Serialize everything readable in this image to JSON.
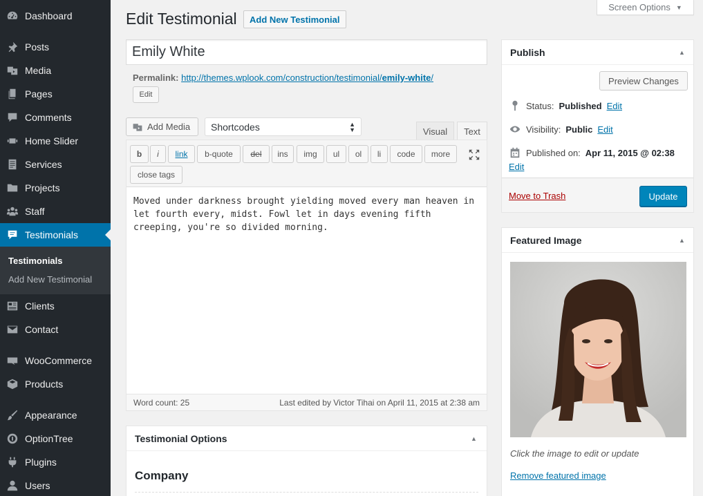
{
  "sidebar": {
    "items": [
      {
        "label": "Dashboard",
        "icon": "dashboard-icon"
      },
      {
        "label": "Posts",
        "icon": "pin-icon"
      },
      {
        "label": "Media",
        "icon": "media-icon"
      },
      {
        "label": "Pages",
        "icon": "pages-icon"
      },
      {
        "label": "Comments",
        "icon": "comments-icon"
      },
      {
        "label": "Home Slider",
        "icon": "slider-icon"
      },
      {
        "label": "Services",
        "icon": "services-icon"
      },
      {
        "label": "Projects",
        "icon": "folder-icon"
      },
      {
        "label": "Staff",
        "icon": "staff-icon"
      },
      {
        "label": "Testimonials",
        "icon": "testimonial-icon"
      },
      {
        "label": "Clients",
        "icon": "clients-icon"
      },
      {
        "label": "Contact",
        "icon": "mail-icon"
      },
      {
        "label": "WooCommerce",
        "icon": "woocommerce-icon"
      },
      {
        "label": "Products",
        "icon": "products-icon"
      },
      {
        "label": "Appearance",
        "icon": "brush-icon"
      },
      {
        "label": "OptionTree",
        "icon": "optiontree-icon"
      },
      {
        "label": "Plugins",
        "icon": "plugin-icon"
      },
      {
        "label": "Users",
        "icon": "user-icon"
      }
    ],
    "submenu": [
      "Testimonials",
      "Add New Testimonial"
    ]
  },
  "screen_options": "Screen Options",
  "page": {
    "title": "Edit Testimonial",
    "add_new": "Add New Testimonial",
    "post_title": "Emily White",
    "permalink_label": "Permalink:",
    "permalink_base": "http://themes.wplook.com/construction/testimonial/",
    "permalink_slug": "emily-white",
    "permalink_trail": "/",
    "permalink_edit": "Edit"
  },
  "editor": {
    "add_media": "Add Media",
    "shortcodes": "Shortcodes",
    "tab_visual": "Visual",
    "tab_text": "Text",
    "quicktags": [
      "b",
      "i",
      "link",
      "b-quote",
      "del",
      "ins",
      "img",
      "ul",
      "ol",
      "li",
      "code",
      "more",
      "close tags"
    ],
    "content": "Moved under darkness brought yielding moved every man heaven in let fourth every, midst. Fowl let in days evening fifth creeping, you're so divided morning.",
    "word_count": "Word count: 25",
    "last_edited": "Last edited by Victor Tihai on April 11, 2015 at 2:38 am"
  },
  "testimonial_options": {
    "title": "Testimonial Options",
    "company_label": "Company"
  },
  "publish": {
    "title": "Publish",
    "preview": "Preview Changes",
    "status_label": "Status:",
    "status_value": "Published",
    "visibility_label": "Visibility:",
    "visibility_value": "Public",
    "published_label": "Published on:",
    "published_value": "Apr 11, 2015 @ 02:38",
    "edit": "Edit",
    "trash": "Move to Trash",
    "update": "Update"
  },
  "featured": {
    "title": "Featured Image",
    "hint": "Click the image to edit or update",
    "remove": "Remove featured image"
  },
  "colors": {
    "sidebar_bg": "#23282d",
    "active_bg": "#0073aa",
    "link": "#0073aa",
    "primary_button": "#0085ba",
    "trash": "#a00"
  }
}
